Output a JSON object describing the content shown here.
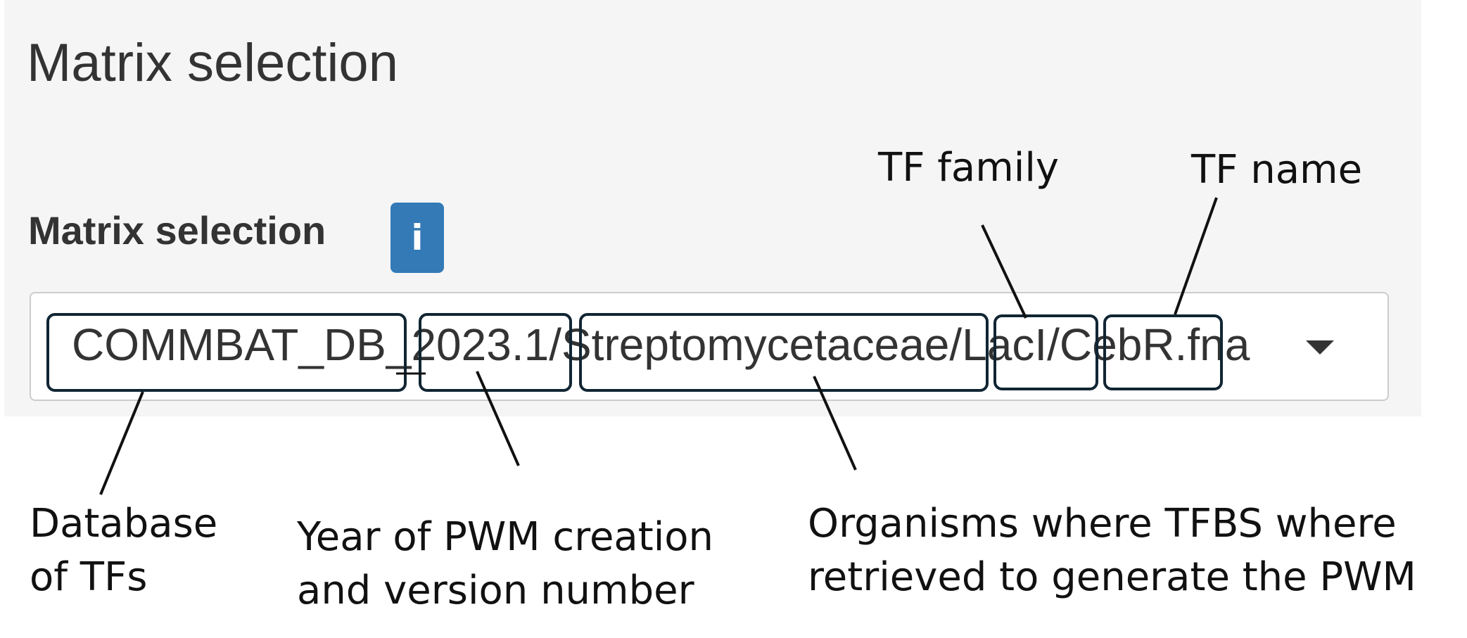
{
  "panel": {
    "title": "Matrix selection",
    "field_label": "Matrix selection",
    "info_icon": "info-icon",
    "info_glyph": "i",
    "select": {
      "value": "COMMBAT_DB_2023.1/Streptomycetaceae/LacI/CebR.fna",
      "dropdown_icon": "caret-down-icon"
    }
  },
  "annotations": {
    "tf_family": "TF family",
    "tf_name": "TF name",
    "database": [
      "Database",
      "of TFs"
    ],
    "year": [
      "Year of PWM creation",
      "and version number"
    ],
    "organisms": [
      "Organisms where TFBS where",
      "retrieved to generate the PWM"
    ]
  },
  "colors": {
    "panel_bg": "#f5f5f5",
    "info_button": "#337ab7",
    "segment_outline": "#112533",
    "text": "#333333"
  }
}
